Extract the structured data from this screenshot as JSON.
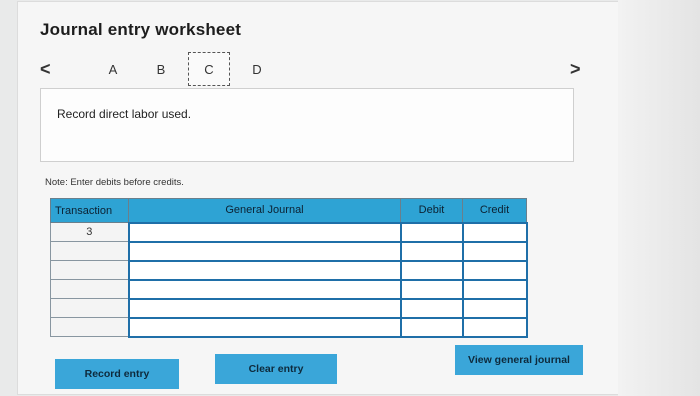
{
  "worksheet": {
    "title": "Journal entry worksheet",
    "tabs": [
      {
        "label": "A",
        "active": false
      },
      {
        "label": "B",
        "active": false
      },
      {
        "label": "C",
        "active": true
      },
      {
        "label": "D",
        "active": false
      }
    ],
    "nav_prev": "<",
    "nav_next": ">",
    "description": "Record direct labor used.",
    "note": "Note: Enter debits before credits."
  },
  "journal_table": {
    "columns": [
      "Transaction",
      "General Journal",
      "Debit",
      "Credit"
    ],
    "rows": [
      {
        "transaction": "3",
        "general_journal": "",
        "debit": "",
        "credit": ""
      },
      {
        "transaction": "",
        "general_journal": "",
        "debit": "",
        "credit": ""
      },
      {
        "transaction": "",
        "general_journal": "",
        "debit": "",
        "credit": ""
      },
      {
        "transaction": "",
        "general_journal": "",
        "debit": "",
        "credit": ""
      },
      {
        "transaction": "",
        "general_journal": "",
        "debit": "",
        "credit": ""
      },
      {
        "transaction": "",
        "general_journal": "",
        "debit": "",
        "credit": ""
      }
    ]
  },
  "buttons": {
    "record_entry": "Record entry",
    "clear_entry": "Clear entry",
    "view_general_journal": "View general journal"
  },
  "colors": {
    "header_blue": "#2ea3d4",
    "button_blue": "#3aa6d9",
    "entry_border": "#1f6fa8"
  }
}
